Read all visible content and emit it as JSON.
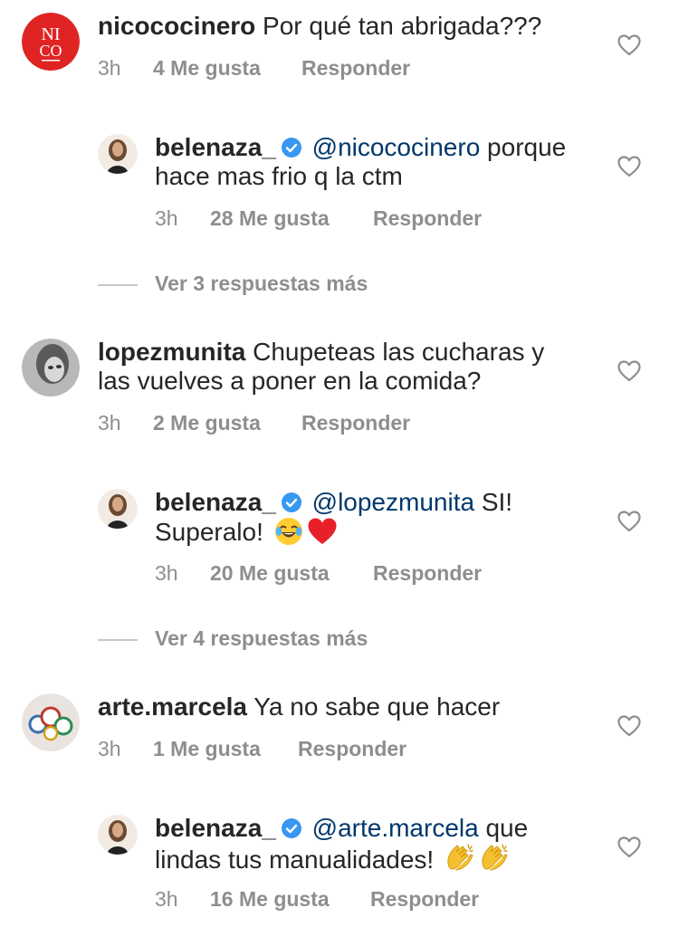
{
  "comments": [
    {
      "avatar_icon": "nico-logo-avatar",
      "username": "nicococinero",
      "text": "Por qué tan abrigada???",
      "time": "3h",
      "likes": "4 Me gusta",
      "reply_label": "Responder",
      "reply": {
        "avatar_icon": "belenaza-avatar",
        "username": "belenaza_",
        "mention": "@nicococinero",
        "text_line1": "porque",
        "text_line2": "hace mas frio q la ctm",
        "time": "3h",
        "likes": "28 Me gusta",
        "reply_label": "Responder"
      },
      "more_replies": "Ver 3 respuestas más"
    },
    {
      "avatar_icon": "lopezmunita-avatar",
      "username": "lopezmunita",
      "text_line1": "Chupeteas las cucharas y",
      "text_line2": "las vuelves a poner en la comida?",
      "time": "3h",
      "likes": "2 Me gusta",
      "reply_label": "Responder",
      "reply": {
        "avatar_icon": "belenaza-avatar",
        "username": "belenaza_",
        "mention": "@lopezmunita",
        "text_line1": "SI!",
        "text_line2": "Superalo!",
        "emojis": [
          "face-with-tears-of-joy-emoji",
          "red-heart-emoji"
        ],
        "time": "3h",
        "likes": "20 Me gusta",
        "reply_label": "Responder"
      },
      "more_replies": "Ver 4 respuestas más"
    },
    {
      "avatar_icon": "arte-marcela-avatar",
      "username": "arte.marcela",
      "text": "Ya no sabe que hacer",
      "time": "3h",
      "likes": "1 Me gusta",
      "reply_label": "Responder",
      "reply": {
        "avatar_icon": "belenaza-avatar",
        "username": "belenaza_",
        "mention": "@arte.marcela",
        "text_line1": "que",
        "text_line2": "lindas tus manualidades!",
        "emojis": [
          "clapping-hands-emoji",
          "clapping-hands-emoji"
        ],
        "time": "3h",
        "likes": "16 Me gusta",
        "reply_label": "Responder"
      }
    }
  ],
  "icons": {
    "like": "heart-outline-icon",
    "verified": "verified-badge-icon"
  },
  "colors": {
    "text": "#262626",
    "muted": "#8e8e8e",
    "mention": "#00376b",
    "verified": "#3897f0",
    "nico_red": "#e02424"
  }
}
